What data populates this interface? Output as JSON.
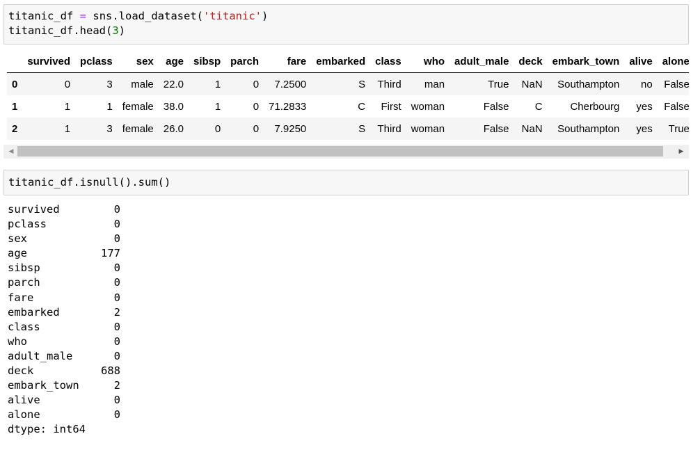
{
  "cells": {
    "cell1": {
      "line1": {
        "var": "titanic_df",
        "op": "=",
        "call": "sns.load_dataset(",
        "arg": "'titanic'",
        "close": ")"
      },
      "line2": {
        "call": "titanic_df.head(",
        "arg": "3",
        "close": ")"
      }
    },
    "cell2": {
      "code": "titanic_df.isnull().sum()"
    }
  },
  "dataframe": {
    "columns": [
      "",
      "survived",
      "pclass",
      "sex",
      "age",
      "sibsp",
      "parch",
      "fare",
      "embarked",
      "class",
      "who",
      "adult_male",
      "deck",
      "embark_town",
      "alive",
      "alone"
    ],
    "rows": [
      [
        "0",
        "0",
        "3",
        "male",
        "22.0",
        "1",
        "0",
        "7.2500",
        "S",
        "Third",
        "man",
        "True",
        "NaN",
        "Southampton",
        "no",
        "False"
      ],
      [
        "1",
        "1",
        "1",
        "female",
        "38.0",
        "1",
        "0",
        "71.2833",
        "C",
        "First",
        "woman",
        "False",
        "C",
        "Cherbourg",
        "yes",
        "False"
      ],
      [
        "2",
        "1",
        "3",
        "female",
        "26.0",
        "0",
        "0",
        "7.9250",
        "S",
        "Third",
        "woman",
        "False",
        "NaN",
        "Southampton",
        "yes",
        "True"
      ]
    ]
  },
  "scrollbar": {
    "left_arrow": "◀",
    "right_arrow": "▶"
  },
  "isnull_output": {
    "rows": [
      [
        "survived",
        "0"
      ],
      [
        "pclass",
        "0"
      ],
      [
        "sex",
        "0"
      ],
      [
        "age",
        "177"
      ],
      [
        "sibsp",
        "0"
      ],
      [
        "parch",
        "0"
      ],
      [
        "fare",
        "0"
      ],
      [
        "embarked",
        "2"
      ],
      [
        "class",
        "0"
      ],
      [
        "who",
        "0"
      ],
      [
        "adult_male",
        "0"
      ],
      [
        "deck",
        "688"
      ],
      [
        "embark_town",
        "2"
      ],
      [
        "alive",
        "0"
      ],
      [
        "alone",
        "0"
      ]
    ],
    "dtype": "dtype: int64"
  }
}
